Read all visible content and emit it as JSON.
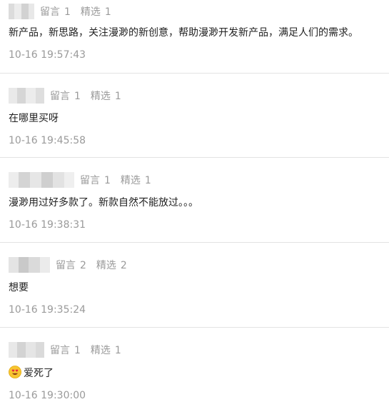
{
  "comments": [
    {
      "reply_label": "留言",
      "reply_count": "1",
      "select_label": "精选",
      "select_count": "1",
      "text": "新产品，新思路，关注漫渺的新创意，帮助漫渺开发新产品，满足人们的需求。",
      "time": "10-16 19:57:43"
    },
    {
      "reply_label": "留言",
      "reply_count": "1",
      "select_label": "精选",
      "select_count": "1",
      "text": "在哪里买呀",
      "time": "10-16 19:45:58"
    },
    {
      "reply_label": "留言",
      "reply_count": "1",
      "select_label": "精选",
      "select_count": "1",
      "text": "漫渺用过好多款了。新款自然不能放过。。。",
      "time": "10-16 19:38:31"
    },
    {
      "reply_label": "留言",
      "reply_count": "2",
      "select_label": "精选",
      "select_count": "2",
      "text": "想要",
      "time": "10-16 19:35:24"
    },
    {
      "reply_label": "留言",
      "reply_count": "1",
      "select_label": "精选",
      "select_count": "1",
      "emoji": "heart-eyes-emoji",
      "text": "爱死了",
      "time": "10-16 19:30:00"
    }
  ],
  "colors": {
    "meta_gray": "#9a9a9a",
    "text": "#222222",
    "divider": "#e3e3e3",
    "blur_light": "#e6e6e6",
    "blur_dark": "#c9c9c9"
  }
}
